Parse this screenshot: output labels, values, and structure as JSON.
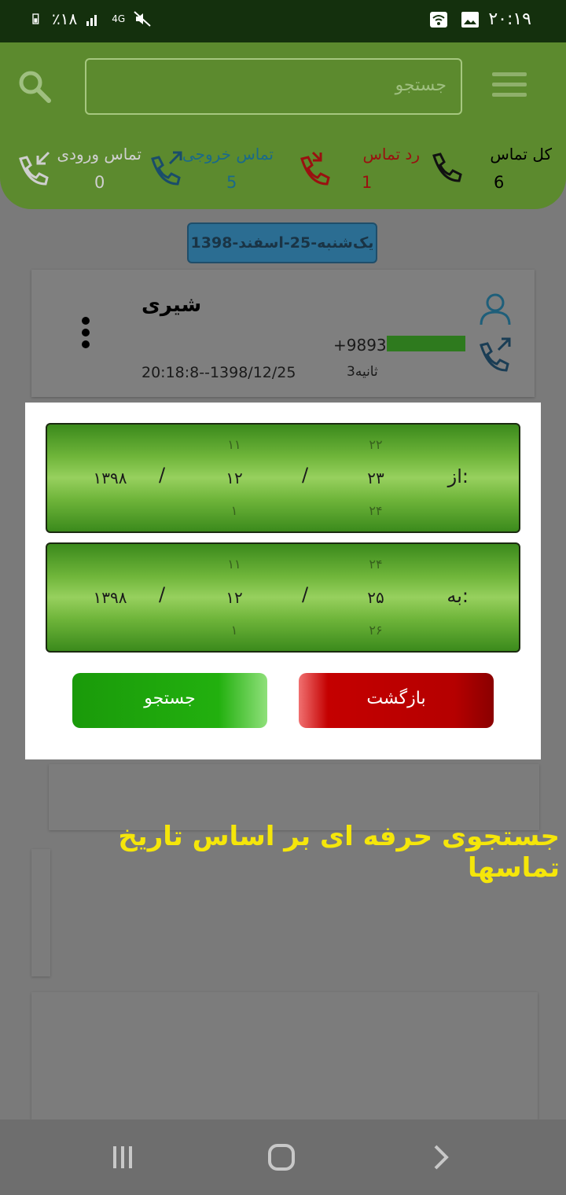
{
  "status_bar": {
    "time": "۲۰:۱۹",
    "battery_text": "٪۱۸",
    "network": "4G"
  },
  "header": {
    "search_placeholder": "جستجو",
    "stats": [
      {
        "label": "کل تماس",
        "count": "6",
        "color": "#000000"
      },
      {
        "label": "رد تماس",
        "count": "1",
        "color": "#b01010"
      },
      {
        "label": "تماس خروجی",
        "count": "5",
        "color": "#1a6a8a"
      },
      {
        "label": "تماس ورودی",
        "count": "0",
        "color": "#cfcfcf"
      }
    ]
  },
  "date_chip": "یک‌شنبه-25-اسفند-1398",
  "call_card": {
    "name": "شیری",
    "phone_prefix": "+98937",
    "duration": "3ثانیه",
    "timestamp": "20:18:8--1398/12/25"
  },
  "dialog": {
    "from": {
      "label": "از:",
      "day": {
        "prev": "۲۲",
        "current": "۲۳",
        "next": "۲۴"
      },
      "month": {
        "prev": "۱۱",
        "current": "۱۲",
        "next": "۱"
      },
      "year": "۱۳۹۸"
    },
    "to": {
      "label": "به:",
      "day": {
        "prev": "۲۴",
        "current": "۲۵",
        "next": "۲۶"
      },
      "month": {
        "prev": "۱۱",
        "current": "۱۲",
        "next": "۱"
      },
      "year": "۱۳۹۸"
    },
    "separator": "/",
    "back_label": "بازگشت",
    "search_label": "جستجو"
  },
  "caption": "جستجوی حرفه ای بر اساس تاریخ تماسها"
}
